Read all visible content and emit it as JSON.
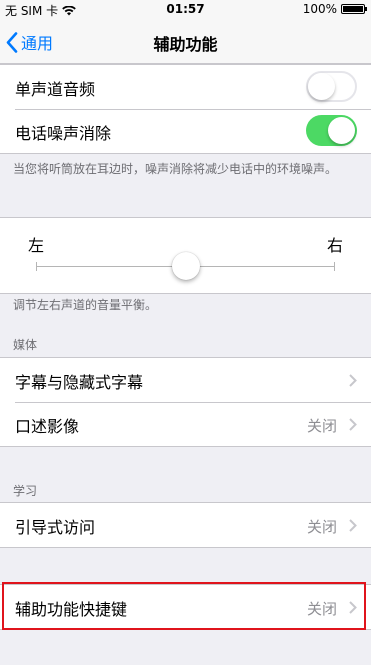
{
  "status_bar": {
    "carrier": "无 SIM 卡",
    "time": "01:57",
    "battery_percent": "100%",
    "battery_level": 1.0
  },
  "nav": {
    "back_label": "通用",
    "title": "辅助功能"
  },
  "audio_group": {
    "mono_audio_label": "单声道音频",
    "mono_audio_on": false,
    "noise_cancel_label": "电话噪声消除",
    "noise_cancel_on": true,
    "accent_color": "#4cd964"
  },
  "noise_cancel_footer": "当您将听筒放在耳边时，噪声消除将减少电话中的环境噪声。",
  "balance": {
    "left_label": "左",
    "right_label": "右",
    "value": 0.5,
    "footer": "调节左右声道的音量平衡。"
  },
  "media_section": {
    "header": "媒体",
    "subtitles_label": "字幕与隐藏式字幕",
    "audio_description_label": "口述影像",
    "audio_description_value": "关闭"
  },
  "learning_section": {
    "header": "学习",
    "guided_access_label": "引导式访问",
    "guided_access_value": "关闭"
  },
  "shortcut": {
    "label": "辅助功能快捷键",
    "value": "关闭",
    "highlight_color": "#e0141c"
  },
  "colors": {
    "ios_blue": "#007aff",
    "background": "#efeff4"
  }
}
